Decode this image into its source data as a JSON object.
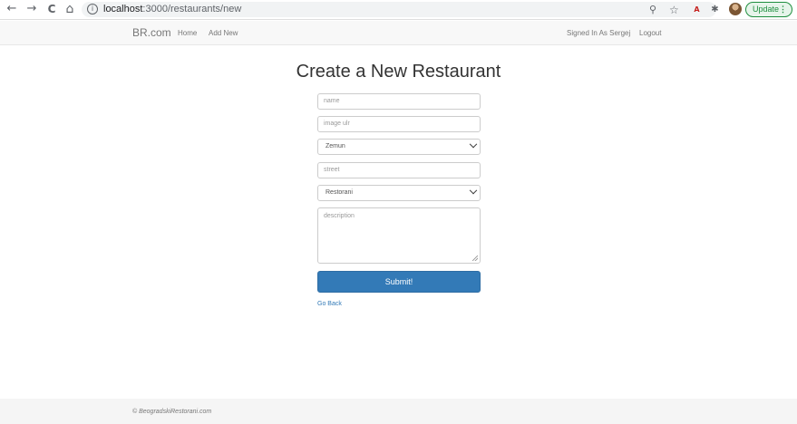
{
  "browser": {
    "back_icon": "←",
    "forward_icon": "→",
    "reload_icon": "C",
    "home_icon": "⌂",
    "info_icon": "i",
    "url_host": "localhost",
    "url_path": ":3000/restaurants/new",
    "zoom_icon": "⚲",
    "star_icon": "☆",
    "update_label": "Update",
    "menu_icon": "⋮"
  },
  "navbar": {
    "brand": "BR.com",
    "links": [
      "Home",
      "Add New"
    ],
    "signed_in": "Signed In As Sergej",
    "logout": "Logout"
  },
  "form": {
    "title": "Create a New Restaurant",
    "name_placeholder": "name",
    "image_placeholder": "image ulr",
    "municipality_selected": "Zemun",
    "street_placeholder": "street",
    "type_selected": "Restorani",
    "description_placeholder": "description",
    "submit_label": "Submit!",
    "go_back": "Go Back"
  },
  "footer": {
    "text": "© BeogradskiRestorani.com"
  },
  "colors": {
    "primary": "#337ab7",
    "navbar_bg": "#f8f8f8",
    "footer_bg": "#f5f5f5"
  }
}
